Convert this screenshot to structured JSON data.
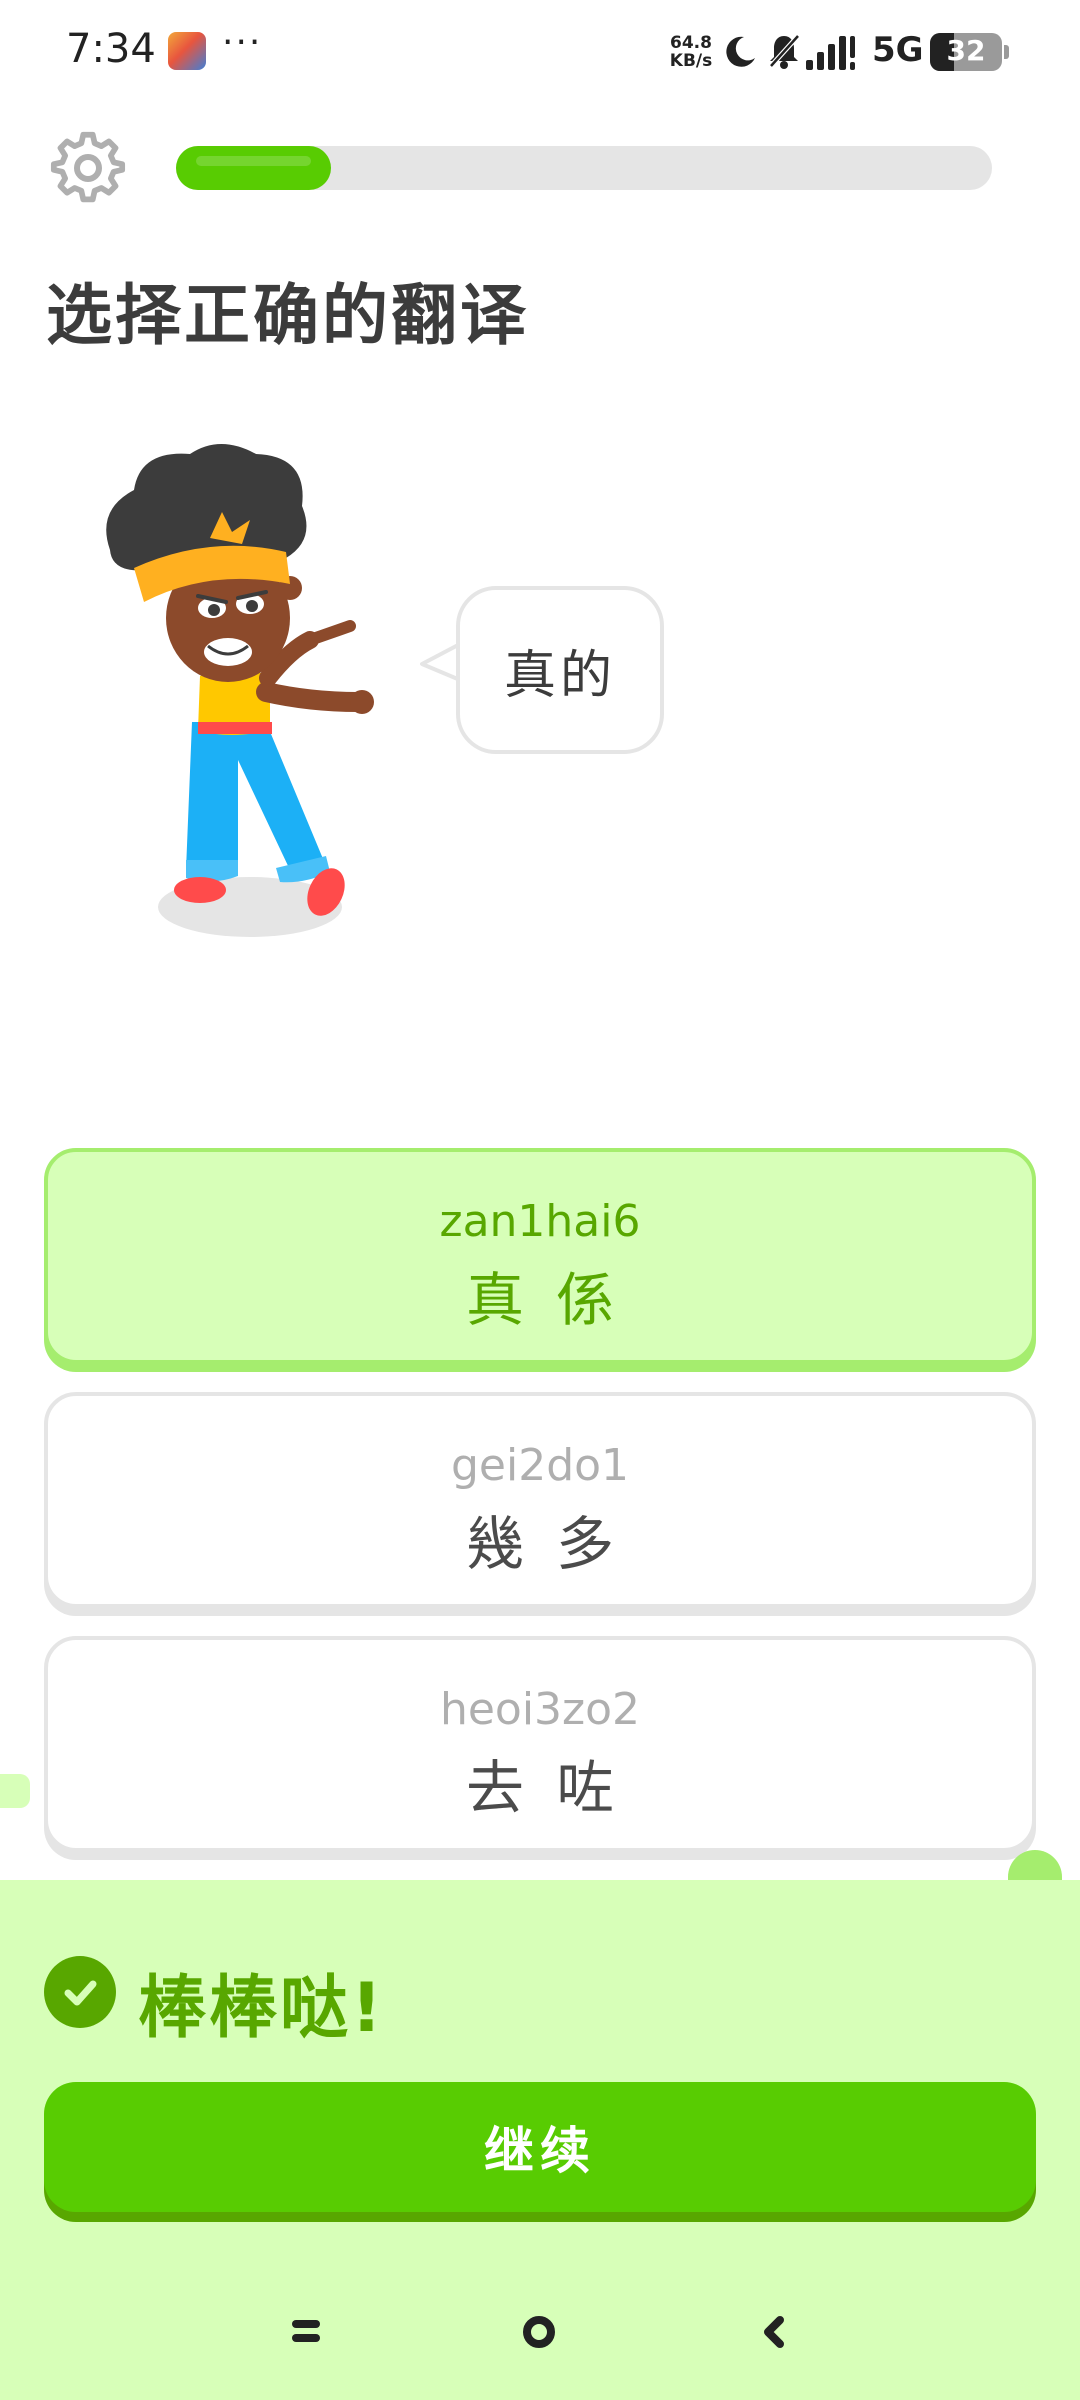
{
  "status_bar": {
    "time": "7:34",
    "more": "···",
    "net_speed_value": "64.8",
    "net_speed_unit": "KB/s",
    "network": "5G",
    "battery": "32"
  },
  "lesson": {
    "progress_fraction": 0.19,
    "prompt": "选择正确的翻译",
    "speech": "真的"
  },
  "options": [
    {
      "romanization": "zan1hai6",
      "characters": "真係",
      "selected": true
    },
    {
      "romanization": "gei2do1",
      "characters": "幾多",
      "selected": false
    },
    {
      "romanization": "heoi3zo2",
      "characters": "去咗",
      "selected": false
    }
  ],
  "feedback": {
    "message": "棒棒哒!",
    "continue_label": "继续"
  },
  "colors": {
    "accent_green": "#58cc02",
    "dark_green": "#58a700",
    "light_green_bg": "#d7ffb8",
    "option_selected_border": "#a5ed6e",
    "neutral_border": "#e5e5e5"
  },
  "icons": [
    "gear-icon",
    "check-icon",
    "moon-icon",
    "bell-off-icon",
    "signal-icon",
    "battery-icon"
  ]
}
